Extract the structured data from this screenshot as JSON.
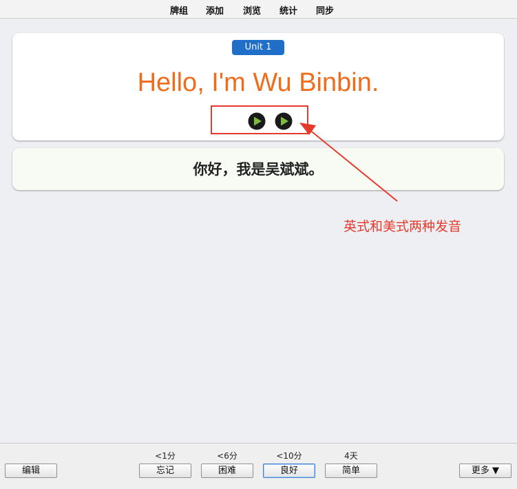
{
  "top_menu": {
    "items": [
      "牌组",
      "添加",
      "浏览",
      "统计",
      "同步"
    ]
  },
  "card_front": {
    "badge": "Unit 1",
    "text": "Hello, I'm Wu Binbin.",
    "audio_buttons": [
      "play-icon",
      "play-icon"
    ]
  },
  "card_back": {
    "text": "你好，我是吴斌斌。"
  },
  "annotation": {
    "text": "英式和美式两种发音",
    "color": "#e53a2b"
  },
  "bottom_bar": {
    "edit_label": "编辑",
    "more_label": "更多 ▼",
    "answers": [
      {
        "interval": "<1分",
        "label": "忘记"
      },
      {
        "interval": "<6分",
        "label": "困难"
      },
      {
        "interval": "<10分",
        "label": "良好"
      },
      {
        "interval": "4天",
        "label": "简单"
      }
    ]
  },
  "colors": {
    "english_text": "#ef6c1b",
    "badge": "#1f6fc9",
    "annotation": "#e53a2b",
    "play_fill": "#7dbb3f"
  }
}
